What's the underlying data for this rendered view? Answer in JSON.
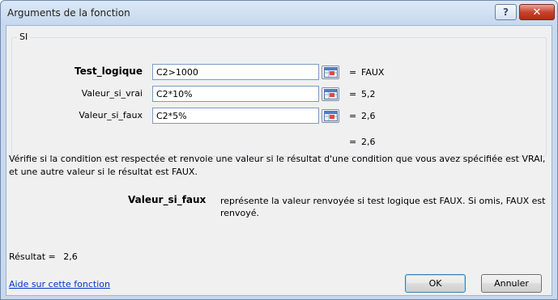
{
  "dialog": {
    "title": "Arguments de la fonction",
    "help_button": "?",
    "close_button": "✕"
  },
  "function_group": {
    "name": "SI",
    "arguments": [
      {
        "label": "Test_logique",
        "value": "C2>1000",
        "equals": "=",
        "result": "FAUX"
      },
      {
        "label": "Valeur_si_vrai",
        "value": "C2*10%",
        "equals": "=",
        "result": "5,2"
      },
      {
        "label": "Valeur_si_faux",
        "value": "C2*5%",
        "equals": "=",
        "result": "2,6"
      }
    ],
    "formula_equals": "=",
    "formula_result": "2,6"
  },
  "description": "Vérifie si la condition est respectée et renvoie une valeur si le résultat d'une condition que vous avez spécifiée est VRAI, et une autre valeur si le résultat est FAUX.",
  "argument_help": {
    "name": "Valeur_si_faux",
    "text": "représente la valeur renvoyée si test logique est FAUX. Si omis, FAUX est renvoyé."
  },
  "result": {
    "label": "Résultat =",
    "value": "2,6"
  },
  "footer": {
    "help_link": "Aide sur cette fonction",
    "ok_label": "OK",
    "cancel_label": "Annuler"
  },
  "icons": {
    "ref_button": "range-selector-icon"
  }
}
